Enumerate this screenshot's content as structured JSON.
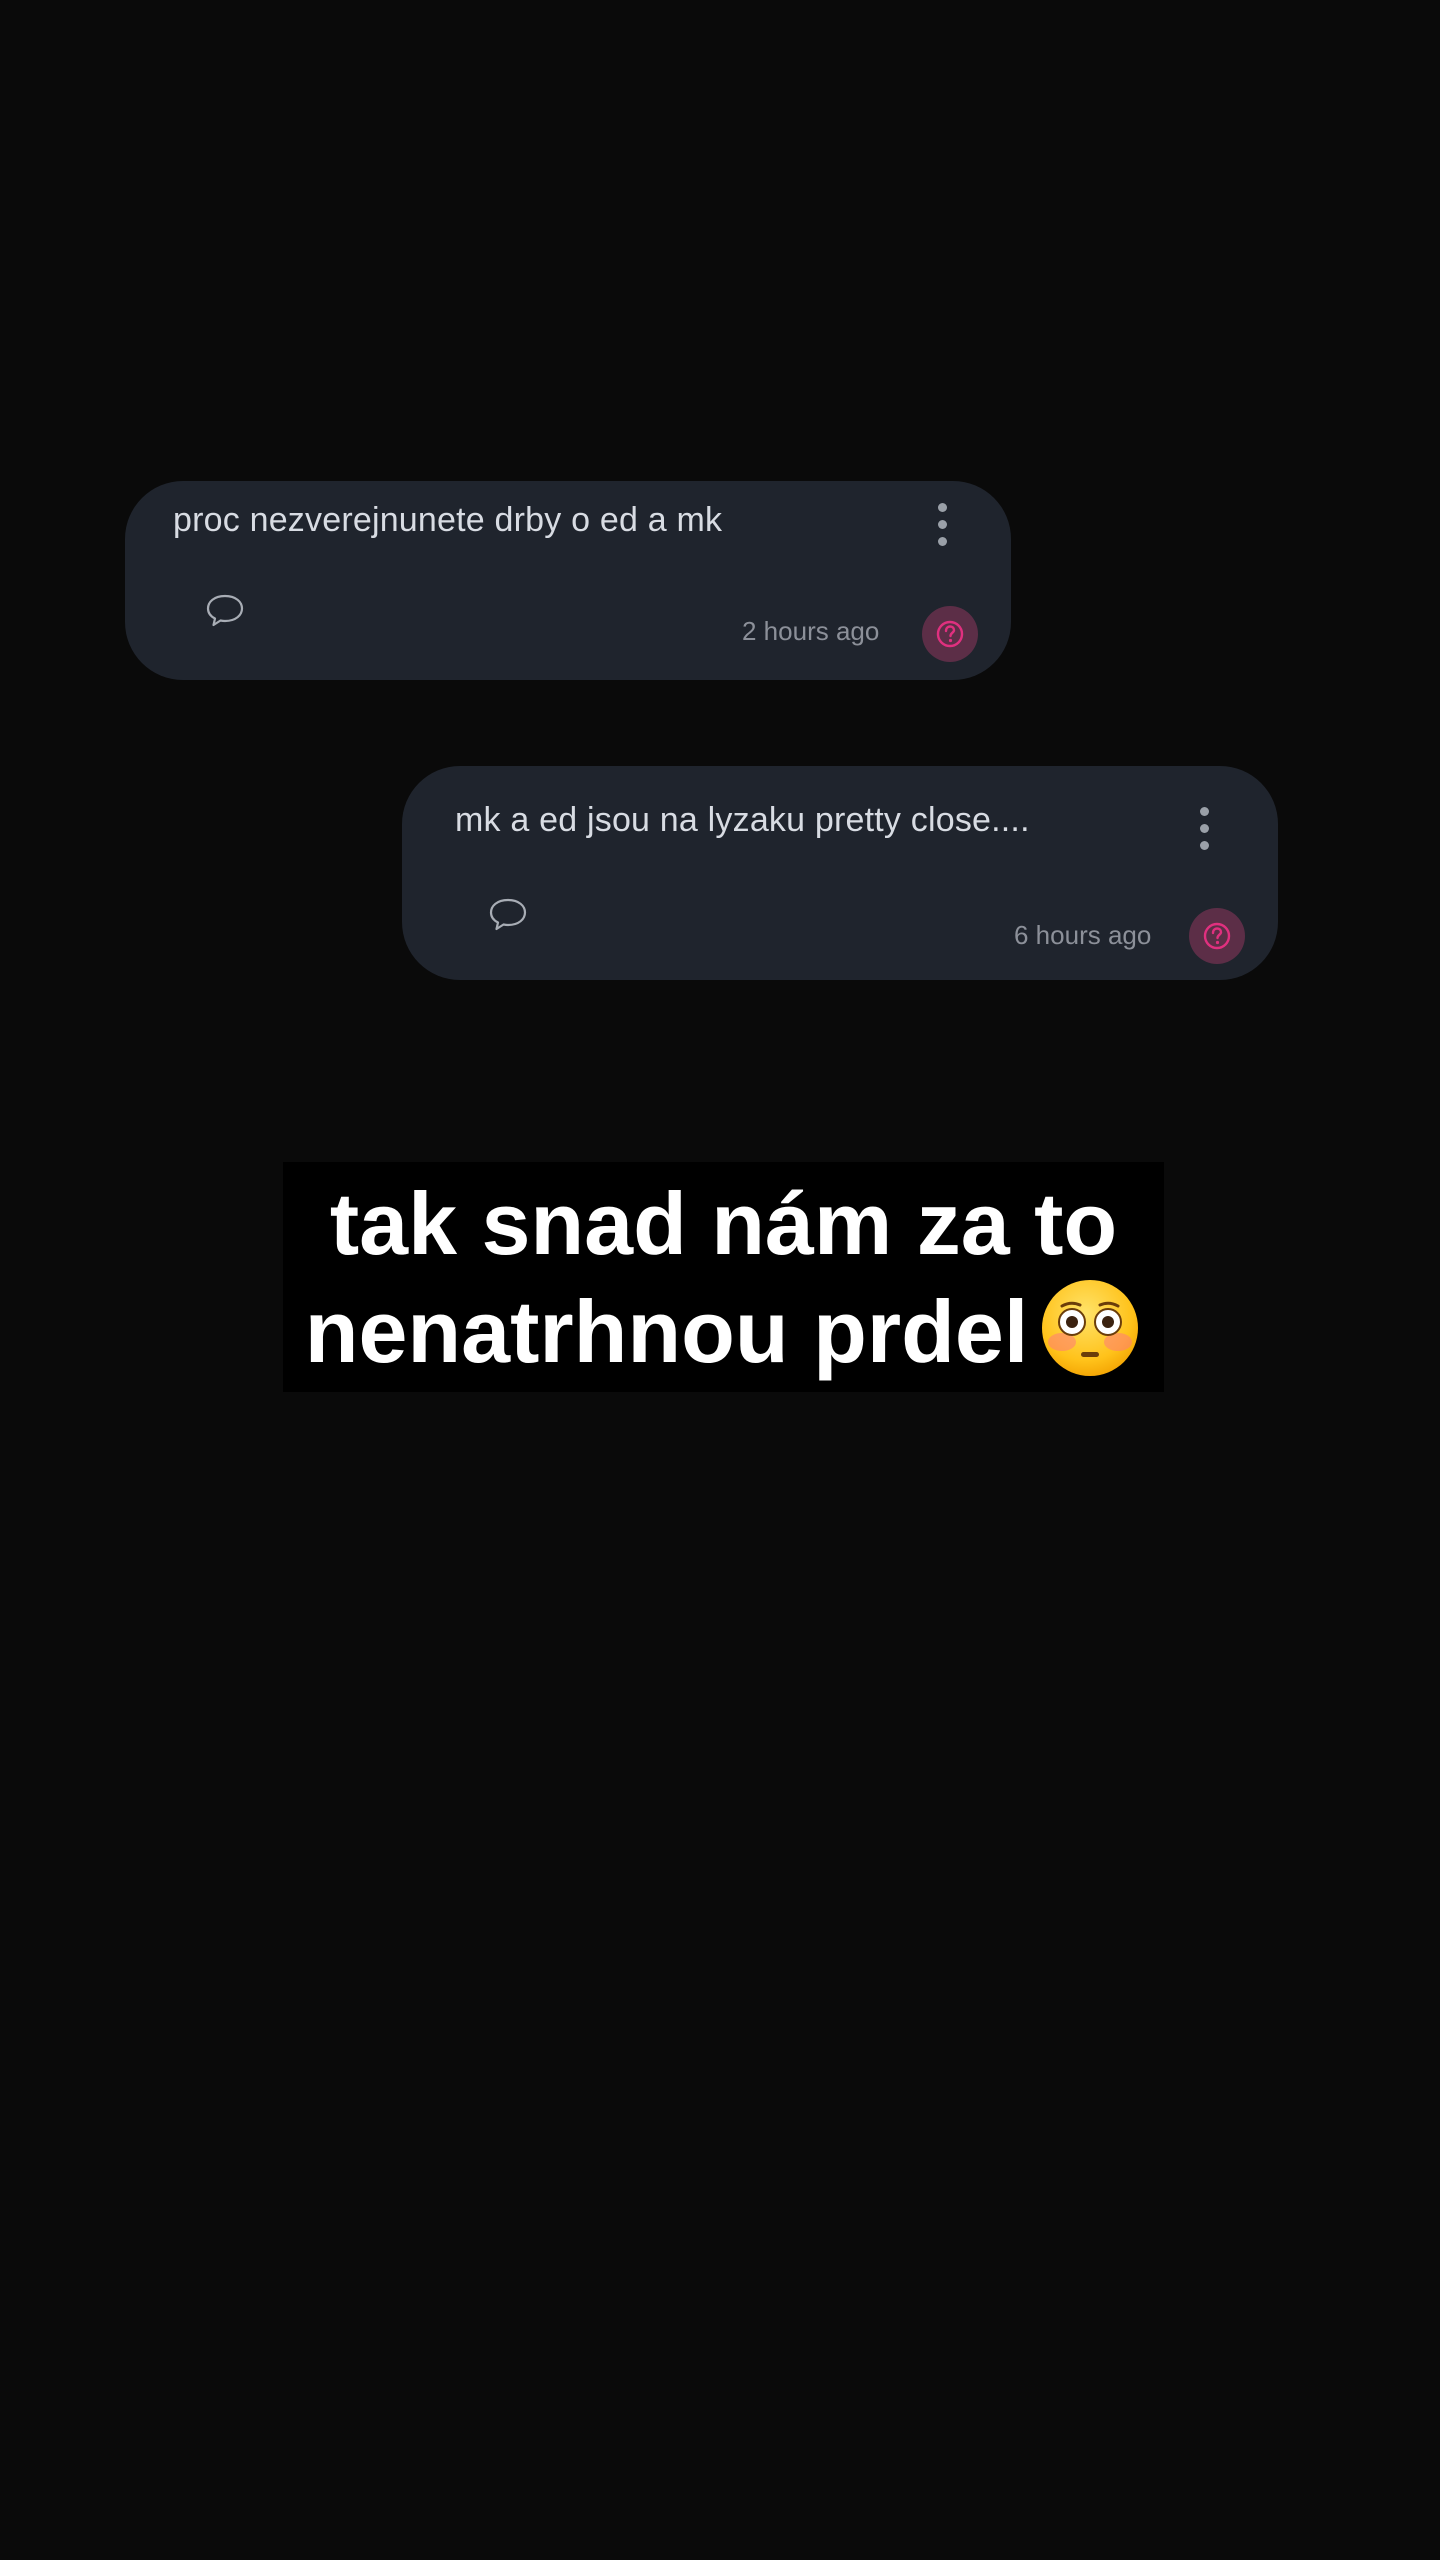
{
  "posts": [
    {
      "text": "proc nezverejnunete drby o ed a mk",
      "time": "2 hours ago"
    },
    {
      "text": "mk a ed jsou na lyzaku pretty close....",
      "time": "6 hours ago"
    }
  ],
  "caption": {
    "line1": "tak snad nám za to",
    "line2": "nenatrhnou prdel",
    "emoji": "flushed-face"
  },
  "colors": {
    "background": "#0a0a0a",
    "card": "#1f242d",
    "accent": "#e0307f",
    "avatar_bg": "#5c2e47"
  }
}
